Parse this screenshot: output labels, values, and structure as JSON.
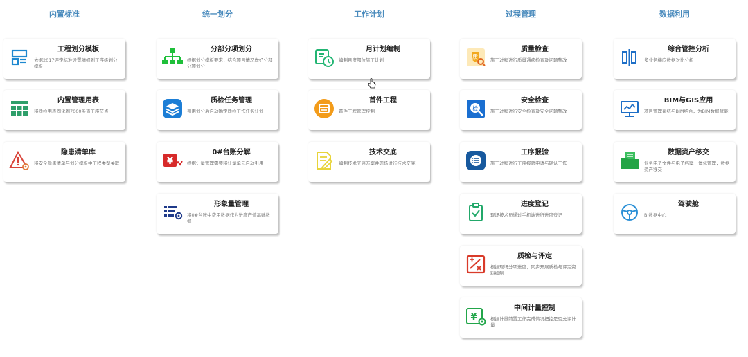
{
  "columns": [
    {
      "title": "内置标准",
      "cards": [
        {
          "title": "工程划分模板",
          "desc": "依据2017评定标准设置精细到工序级划分模板",
          "icon": "template-layout-icon"
        },
        {
          "title": "内置管理用表",
          "desc": "将质检用表固化到7000多道工序节点",
          "icon": "table-grid-icon"
        },
        {
          "title": "隐患清单库",
          "desc": "将安全隐患清单与划分模板中工程类型关联",
          "icon": "warning-gear-icon"
        }
      ]
    },
    {
      "title": "统一划分",
      "cards": [
        {
          "title": "分部分项划分",
          "desc": "根据划分模板要求，结合项目情况做好分部分项划分",
          "icon": "org-tree-icon"
        },
        {
          "title": "质检任务管理",
          "desc": "引用划分后自动确定质检工作任务计划",
          "icon": "layers-icon"
        },
        {
          "title": "0#台账分解",
          "desc": "根据计量管理需要将计量单元自动引用",
          "icon": "yuan-ledger-icon"
        },
        {
          "title": "形象量管理",
          "desc": "将0#台账中费用数据作为进度产值基础数据",
          "icon": "list-gear-icon"
        }
      ]
    },
    {
      "title": "工作计划",
      "cards": [
        {
          "title": "月计划编制",
          "desc": "编制月度部位施工计划",
          "icon": "calendar-clock-icon"
        },
        {
          "title": "首件工程",
          "desc": "首件工程管理控制",
          "icon": "window-badge-icon"
        },
        {
          "title": "技术交底",
          "desc": "编制技术交底方案并现场进行技术交底",
          "icon": "document-pen-icon"
        }
      ]
    },
    {
      "title": "过程管理",
      "cards": [
        {
          "title": "质量检查",
          "desc": "施工过程进行质量通病检查及问题整改",
          "icon": "quality-shield-icon"
        },
        {
          "title": "安全检查",
          "desc": "施工过程进行安全检查及安全问题整改",
          "icon": "inspect-search-icon"
        },
        {
          "title": "工序报验",
          "desc": "施工过程进行工序报验申请与确认工作",
          "icon": "process-report-icon"
        },
        {
          "title": "进度登记",
          "desc": "现场技术员通过手机端进行进度登记",
          "icon": "clipboard-check-icon"
        },
        {
          "title": "质检与评定",
          "desc": "根据现场分项进度，同步开展质检与评定资料编制",
          "icon": "evaluate-icon"
        },
        {
          "title": "中间计量控制",
          "desc": "根据计量前置工作完成情况把控是否允许计量",
          "icon": "yuan-gear-icon"
        }
      ]
    },
    {
      "title": "数据利用",
      "cards": [
        {
          "title": "综合管控分析",
          "desc": "多业务横向数据对比分析",
          "icon": "columns-compare-icon"
        },
        {
          "title": "BIM与GIS应用",
          "desc": "项目管理系统与BIM结合，为BIM数据赋能",
          "icon": "monitor-chart-icon"
        },
        {
          "title": "数据资产移交",
          "desc": "业务电子文件与电子档案一体化管理，数据资产移交",
          "icon": "folder-docs-icon"
        },
        {
          "title": "驾驶舱",
          "desc": "BI数据中心",
          "icon": "steering-wheel-icon"
        }
      ]
    }
  ]
}
